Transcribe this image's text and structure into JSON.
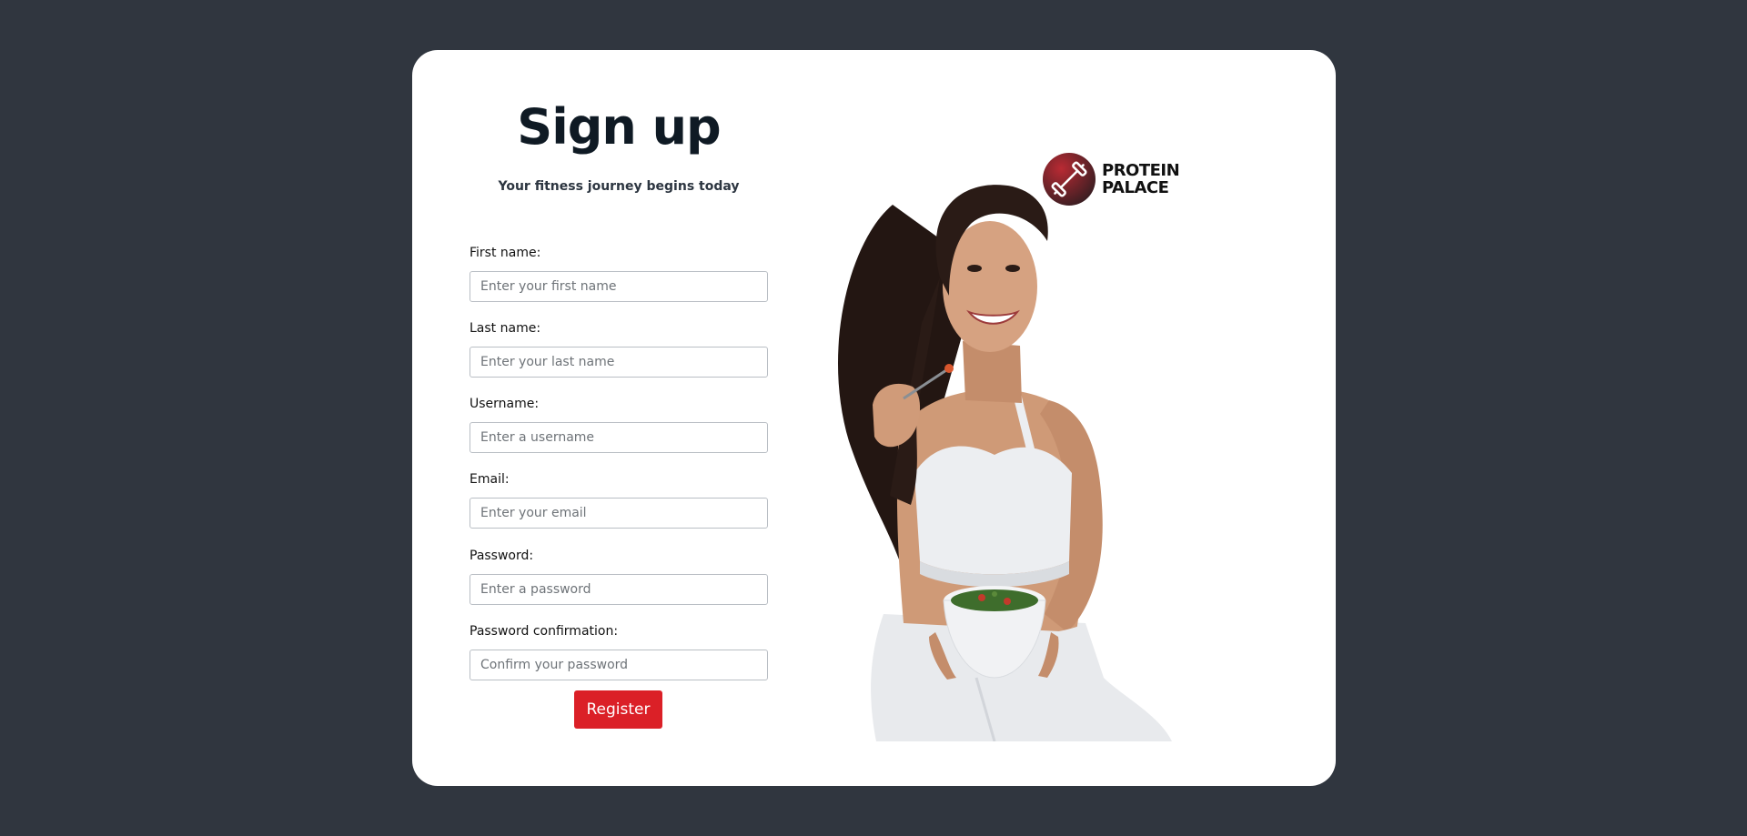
{
  "page": {
    "title": "Sign up",
    "subtitle": "Your fitness journey begins today"
  },
  "form": {
    "fields": [
      {
        "label": "First name:",
        "placeholder": "Enter your first name",
        "value": ""
      },
      {
        "label": "Last name:",
        "placeholder": "Enter your last name",
        "value": ""
      },
      {
        "label": "Username:",
        "placeholder": "Enter a username",
        "value": ""
      },
      {
        "label": "Email:",
        "placeholder": "Enter your email",
        "value": ""
      },
      {
        "label": "Password:",
        "placeholder": "Enter a password",
        "value": ""
      },
      {
        "label": "Password confirmation:",
        "placeholder": "Confirm your password",
        "value": ""
      }
    ],
    "register_label": "Register"
  },
  "brand": {
    "line1": "PROTEIN",
    "line2": "PALACE",
    "icon": "dumbbell-icon",
    "color": "#9b1c27"
  },
  "colors": {
    "background": "#30363f",
    "card": "#ffffff",
    "accent": "#db2027"
  },
  "hero": {
    "image": "woman-eating-salad"
  }
}
